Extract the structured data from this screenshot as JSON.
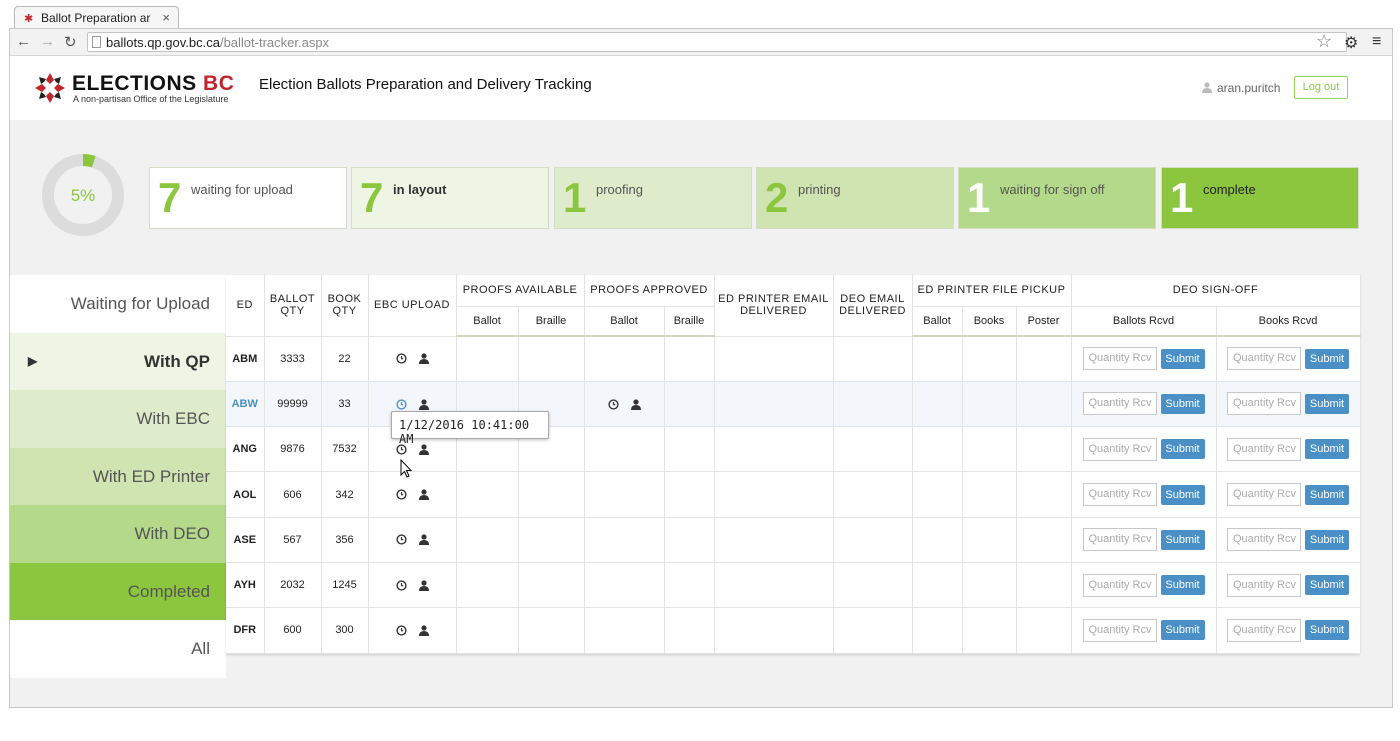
{
  "browser": {
    "tab_title": "Ballot Preparation ar",
    "url_host": "ballots.qp.gov.bc.ca",
    "url_path": "/ballot-tracker.aspx"
  },
  "header": {
    "logo_word": "ELECTIONS",
    "logo_word_accent": "BC",
    "logo_tagline": "A non-partisan Office of the Legislature",
    "app_title": "Election Ballots Preparation and Delivery Tracking",
    "username": "aran.puritch",
    "logout_label": "Log out"
  },
  "summary": {
    "percent_label": "5%",
    "percent_value": 5,
    "stats": [
      {
        "count": "7",
        "label": "waiting for upload",
        "bg": "#ffffff"
      },
      {
        "count": "7",
        "label": "in layout",
        "bg": "#eef5e4"
      },
      {
        "count": "1",
        "label": "proofing",
        "bg": "#dfeccc"
      },
      {
        "count": "2",
        "label": "printing",
        "bg": "#cfe4b0"
      },
      {
        "count": "1",
        "label": "waiting for sign off",
        "bg": "#b5d98a"
      },
      {
        "count": "1",
        "label": "complete",
        "bg": "#8cc63f"
      }
    ]
  },
  "filters": [
    {
      "label": "Waiting for Upload",
      "bg": "#ffffff",
      "selected": false
    },
    {
      "label": "With QP",
      "bg": "#eef5e4",
      "selected": true
    },
    {
      "label": "With EBC",
      "bg": "#dfeccc",
      "selected": false
    },
    {
      "label": "With ED Printer",
      "bg": "#cfe4b0",
      "selected": false
    },
    {
      "label": "With DEO",
      "bg": "#b5d98a",
      "selected": false
    },
    {
      "label": "Completed",
      "bg": "#8cc63f",
      "selected": false
    },
    {
      "label": "All",
      "bg": "#ffffff",
      "selected": false
    }
  ],
  "table": {
    "headers": {
      "ed": "ED",
      "ballot_qty": "BALLOT QTY",
      "book_qty": "BOOK QTY",
      "ebc_upload": "EBC UPLOAD",
      "proofs_available": "PROOFS AVAILABLE",
      "proofs_approved": "PROOFS APPROVED",
      "ed_printer_email": "ED PRINTER EMAIL DELIVERED",
      "deo_email": "DEO EMAIL DELIVERED",
      "ed_printer_pickup": "ED PRINTER FILE PICKUP",
      "deo_signoff": "DEO SIGN-OFF",
      "ballot": "Ballot",
      "braille": "Braille",
      "books": "Books",
      "poster": "Poster",
      "ballots_rcvd": "Ballots Rcvd",
      "books_rcvd": "Books Rcvd"
    },
    "qty_placeholder": "Quantity Rcv",
    "submit_label": "Submit",
    "rows": [
      {
        "ed": "ABM",
        "ballot_qty": "3333",
        "book_qty": "22",
        "approved": false,
        "hover": false
      },
      {
        "ed": "ABW",
        "ballot_qty": "99999",
        "book_qty": "33",
        "approved": true,
        "hover": true
      },
      {
        "ed": "ANG",
        "ballot_qty": "9876",
        "book_qty": "7532",
        "approved": false,
        "hover": false
      },
      {
        "ed": "AOL",
        "ballot_qty": "606",
        "book_qty": "342",
        "approved": false,
        "hover": false
      },
      {
        "ed": "ASE",
        "ballot_qty": "567",
        "book_qty": "356",
        "approved": false,
        "hover": false
      },
      {
        "ed": "AYH",
        "ballot_qty": "2032",
        "book_qty": "1245",
        "approved": false,
        "hover": false
      },
      {
        "ed": "DFR",
        "ballot_qty": "600",
        "book_qty": "300",
        "approved": false,
        "hover": false
      }
    ]
  },
  "tooltip": {
    "text": "1/12/2016 10:41:00 AM"
  },
  "colors": {
    "accent_green": "#8cc63f",
    "button_blue": "#4a8fc5",
    "brand_red": "#c0262d"
  }
}
